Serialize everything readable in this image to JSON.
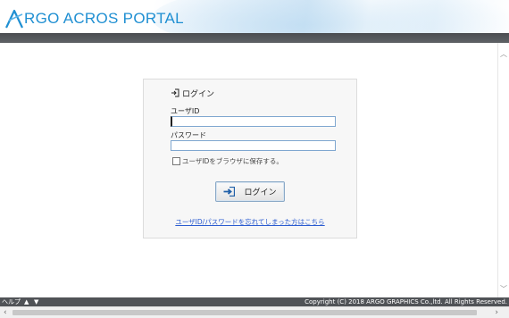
{
  "header": {
    "logo_text": "RGO ACROS PORTAL",
    "brand_color": "#1f8fd2"
  },
  "login": {
    "heading": "ログイン",
    "userid_label": "ユーザID",
    "userid_value": "",
    "password_label": "パスワード",
    "password_value": "",
    "remember_label": "ユーザIDをブラウザに保存する。",
    "remember_checked": false,
    "button_label": "ログイン",
    "forgot_link": "ユーザID/パスワードを忘れてしまった方はこちら",
    "link_color": "#2a5bd0"
  },
  "footer": {
    "help_label": "ヘルプ",
    "nav_up": "▲",
    "nav_down": "▼",
    "copyright": "Copyright (C) 2018 ARGO GRAPHICS Co.,ltd. All Rights Reserved."
  },
  "icons": {
    "login_heading_icon": "login-icon",
    "login_button_icon": "login-arrow-icon"
  }
}
